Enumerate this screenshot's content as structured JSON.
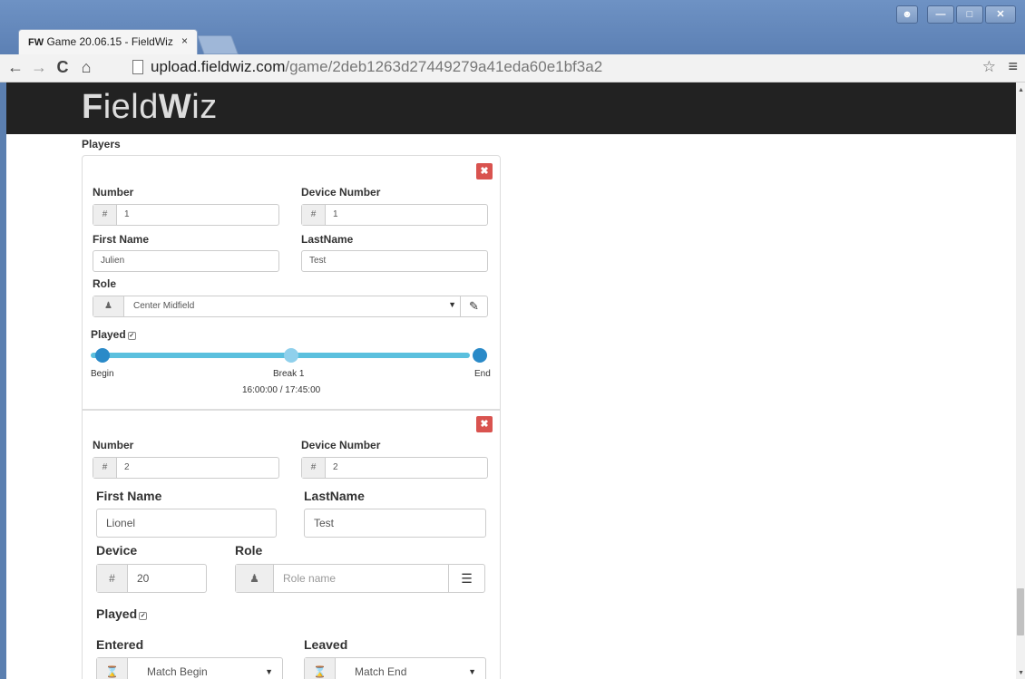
{
  "browser": {
    "tab_title_bold": "FW",
    "tab_title": "Game 20.06.15 - FieldWiz",
    "tab_close": "×",
    "url_host": "upload.fieldwiz.com",
    "url_path": "/game/2deb1263d27449279a41eda60e1bf3a2"
  },
  "brand": {
    "part1": "F",
    "part2": "ield",
    "part3": "W",
    "part4": "iz"
  },
  "players_title": "Players",
  "player1": {
    "number_label": "Number",
    "number_addon": "#",
    "number_value": "1",
    "device_number_label": "Device Number",
    "device_number_addon": "#",
    "device_number_value": "1",
    "first_name_label": "First Name",
    "first_name_value": "Julien",
    "last_name_label": "LastName",
    "last_name_value": "Test",
    "role_label": "Role",
    "role_value": "Center Midfield",
    "played_label": "Played",
    "slider": {
      "begin": "Begin",
      "break": "Break 1",
      "end": "End",
      "time": "16:00:00 / 17:45:00"
    }
  },
  "player2": {
    "number_label": "Number",
    "number_addon": "#",
    "number_value": "2",
    "device_number_label": "Device Number",
    "device_number_addon": "#",
    "device_number_value": "2",
    "first_name_label": "First Name",
    "first_name_value": "Lionel",
    "last_name_label": "LastName",
    "last_name_value": "Test",
    "device_label": "Device",
    "device_addon": "#",
    "device_value": "20",
    "role_label": "Role",
    "role_placeholder": "Role name",
    "played_label": "Played",
    "entered_label": "Entered",
    "entered_value": "Match Begin",
    "leaved_label": "Leaved",
    "leaved_value": "Match End"
  }
}
